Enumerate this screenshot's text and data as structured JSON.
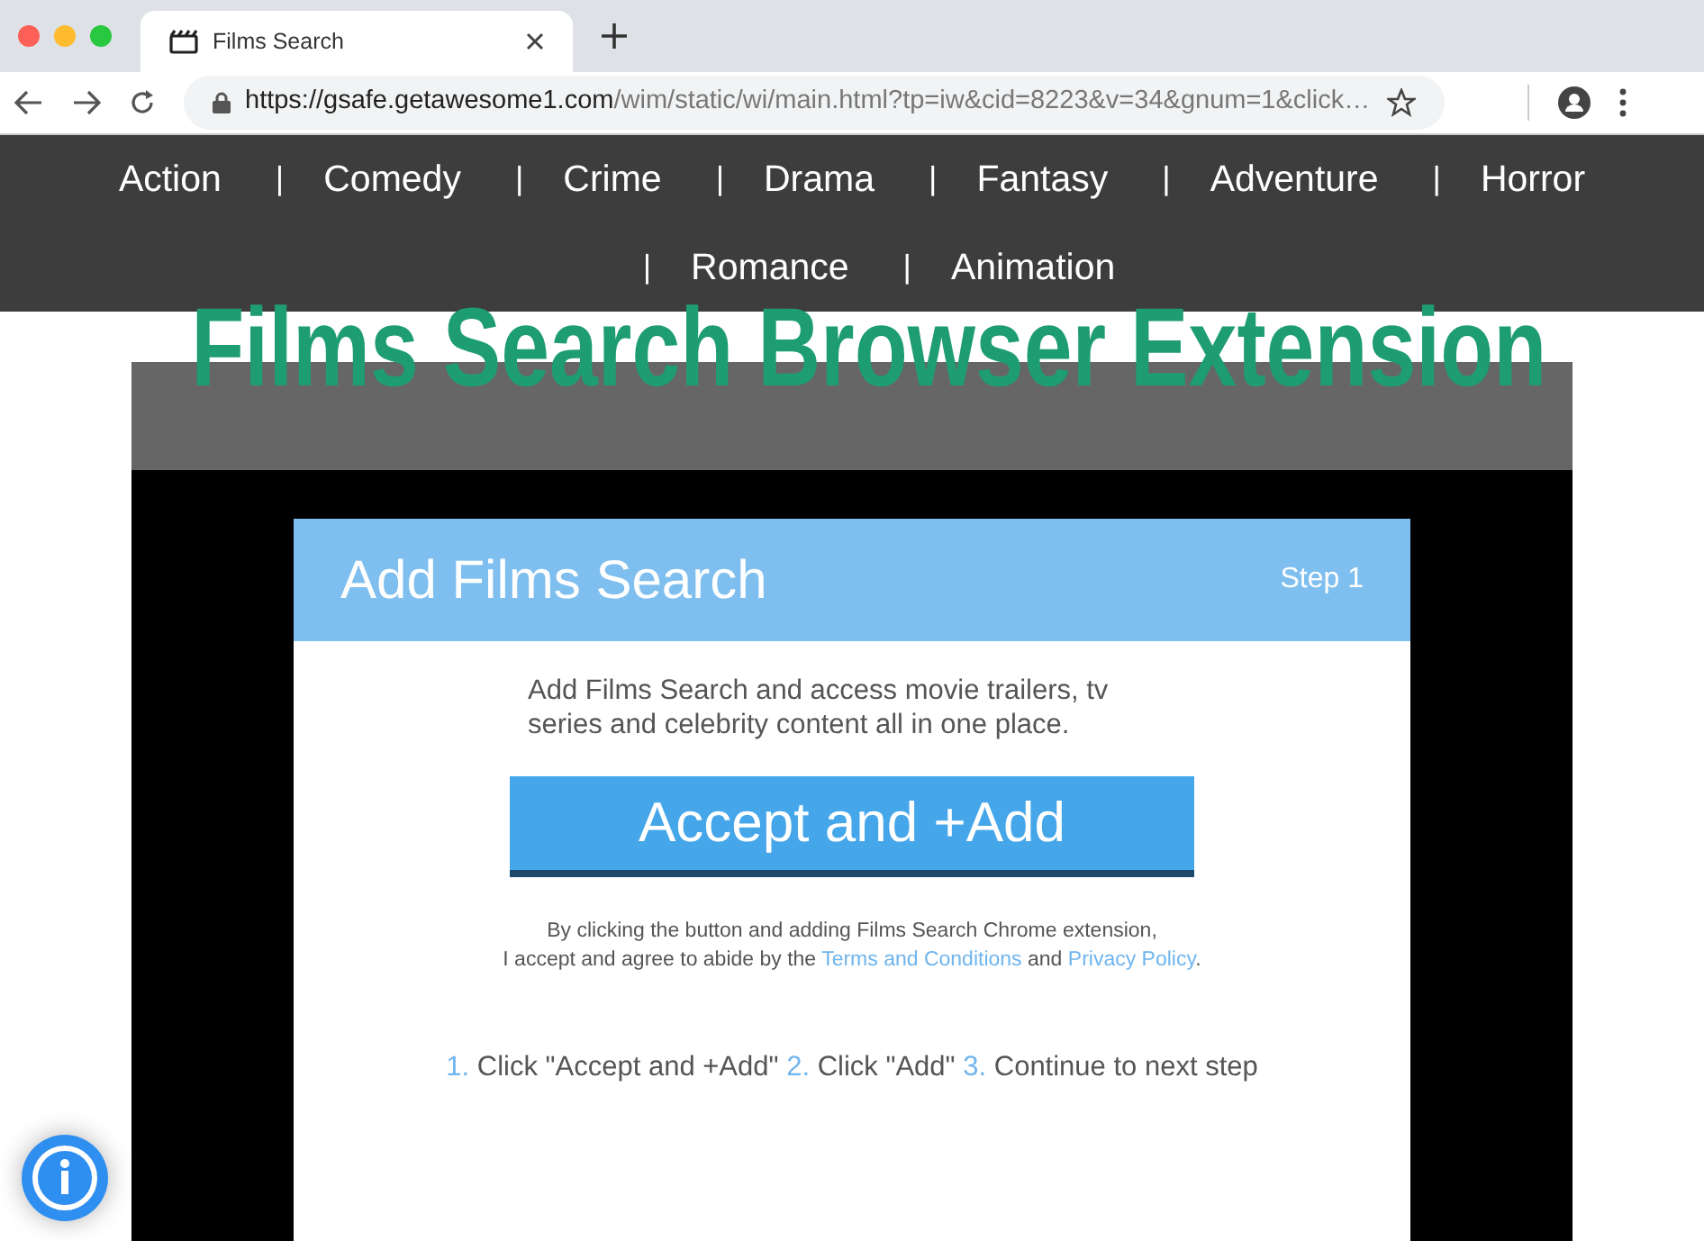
{
  "browser": {
    "tab_title": "Films Search",
    "url_host": "https://gsafe.getawesome1.com",
    "url_path": "/wim/static/wi/main.html?tp=iw&cid=8223&v=34&gnum=1&click…"
  },
  "nav": {
    "items": [
      {
        "label": "Action"
      },
      {
        "separator": "|",
        "label": "Comedy"
      },
      {
        "separator": "|",
        "label": "Crime"
      },
      {
        "separator": "|",
        "label": "Drama"
      },
      {
        "separator": "|",
        "label": "Fantasy"
      },
      {
        "separator": "|",
        "label": "Adventure"
      },
      {
        "separator": "|",
        "label": "Horror"
      },
      {
        "separator": "|",
        "label": "Romance"
      },
      {
        "separator": "|",
        "label": "Animation"
      }
    ]
  },
  "headline": "Films Search Browser Extension",
  "card": {
    "title": "Add Films Search",
    "step": "Step 1",
    "intro": "Add Films Search and access movie trailers, tv series and celebrity content all in one place.",
    "button": "Accept and +Add",
    "legal_line1": "By clicking the button and adding Films Search Chrome extension,",
    "legal_line2": "I accept and agree to abide by the",
    "terms_link": "Terms and Conditions",
    "and_text": "and",
    "privacy_link": "Privacy Policy",
    "end_text": ".",
    "steps": [
      {
        "number": "1.",
        "text": "Click \"Accept and +Add\""
      },
      {
        "number": "2.",
        "text": "Click \"Add\""
      },
      {
        "number": "3.",
        "text": "Continue to next step"
      }
    ]
  }
}
